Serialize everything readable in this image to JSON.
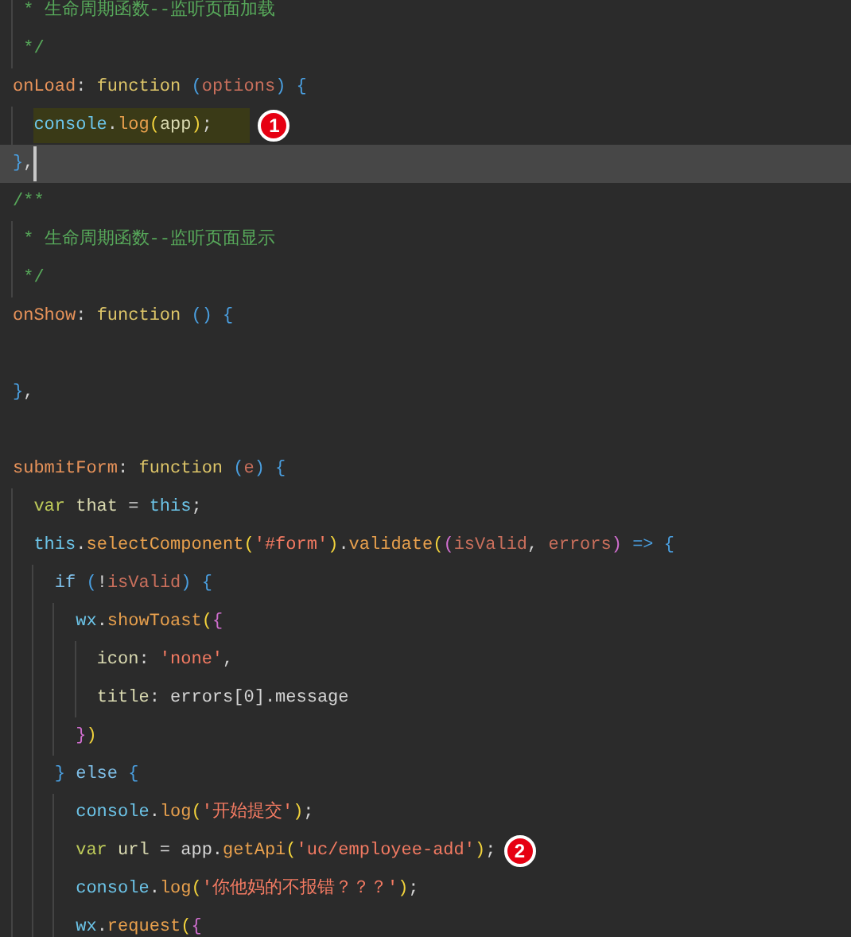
{
  "editor": {
    "lines": [
      {
        "kind": "code",
        "highlighted": false,
        "current": false,
        "tokens": [
          {
            "kind": "com",
            "text": " * 生命周期函数--监听页面加载"
          }
        ]
      },
      {
        "kind": "code",
        "highlighted": false,
        "current": false,
        "tokens": [
          {
            "kind": "com",
            "text": " */"
          }
        ]
      },
      {
        "kind": "code",
        "highlighted": false,
        "current": false,
        "tokens": [
          {
            "kind": "prop",
            "text": "onLoad"
          },
          {
            "kind": "p",
            "text": ": "
          },
          {
            "kind": "kw",
            "text": "function "
          },
          {
            "kind": "b1",
            "text": "("
          },
          {
            "kind": "param",
            "text": "options"
          },
          {
            "kind": "b1",
            "text": ") {"
          }
        ]
      },
      {
        "kind": "code",
        "highlighted": true,
        "current": false,
        "badge": "1",
        "tokens": [
          {
            "kind": "obj",
            "text": "  console"
          },
          {
            "kind": "p",
            "text": "."
          },
          {
            "kind": "fn",
            "text": "log"
          },
          {
            "kind": "b2",
            "text": "("
          },
          {
            "kind": "var",
            "text": "app"
          },
          {
            "kind": "b2",
            "text": ")"
          },
          {
            "kind": "p",
            "text": ";"
          }
        ]
      },
      {
        "kind": "code",
        "highlighted": false,
        "current": true,
        "tokens": [
          {
            "kind": "b1",
            "text": "}"
          },
          {
            "kind": "p",
            "text": ","
          }
        ]
      },
      {
        "kind": "code",
        "highlighted": false,
        "current": false,
        "tokens": [
          {
            "kind": "com",
            "text": "/**"
          }
        ]
      },
      {
        "kind": "code",
        "highlighted": false,
        "current": false,
        "tokens": [
          {
            "kind": "com",
            "text": " * 生命周期函数--监听页面显示"
          }
        ]
      },
      {
        "kind": "code",
        "highlighted": false,
        "current": false,
        "tokens": [
          {
            "kind": "com",
            "text": " */"
          }
        ]
      },
      {
        "kind": "code",
        "highlighted": false,
        "current": false,
        "tokens": [
          {
            "kind": "prop",
            "text": "onShow"
          },
          {
            "kind": "p",
            "text": ": "
          },
          {
            "kind": "kw",
            "text": "function "
          },
          {
            "kind": "b1",
            "text": "() {"
          }
        ]
      },
      {
        "kind": "blank"
      },
      {
        "kind": "code",
        "highlighted": false,
        "current": false,
        "tokens": [
          {
            "kind": "b1",
            "text": "}"
          },
          {
            "kind": "p",
            "text": ","
          }
        ]
      },
      {
        "kind": "blank"
      },
      {
        "kind": "code",
        "highlighted": false,
        "current": false,
        "tokens": [
          {
            "kind": "prop",
            "text": "submitForm"
          },
          {
            "kind": "p",
            "text": ": "
          },
          {
            "kind": "kw",
            "text": "function "
          },
          {
            "kind": "b1",
            "text": "("
          },
          {
            "kind": "param",
            "text": "e"
          },
          {
            "kind": "b1",
            "text": ") {"
          }
        ]
      },
      {
        "kind": "code",
        "highlighted": false,
        "current": false,
        "tokens": [
          {
            "kind": "kwv",
            "text": "  var "
          },
          {
            "kind": "var",
            "text": "that"
          },
          {
            "kind": "p",
            "text": " = "
          },
          {
            "kind": "obj",
            "text": "this"
          },
          {
            "kind": "p",
            "text": ";"
          }
        ]
      },
      {
        "kind": "code",
        "highlighted": false,
        "current": false,
        "tokens": [
          {
            "kind": "obj",
            "text": "  this"
          },
          {
            "kind": "p",
            "text": "."
          },
          {
            "kind": "fn",
            "text": "selectComponent"
          },
          {
            "kind": "b2",
            "text": "("
          },
          {
            "kind": "str",
            "text": "'#form'"
          },
          {
            "kind": "b2",
            "text": ")"
          },
          {
            "kind": "p",
            "text": "."
          },
          {
            "kind": "fn",
            "text": "validate"
          },
          {
            "kind": "b2",
            "text": "("
          },
          {
            "kind": "b3",
            "text": "("
          },
          {
            "kind": "param",
            "text": "isValid"
          },
          {
            "kind": "p",
            "text": ", "
          },
          {
            "kind": "param",
            "text": "errors"
          },
          {
            "kind": "b3",
            "text": ")"
          },
          {
            "kind": "b1",
            "text": " => {"
          }
        ]
      },
      {
        "kind": "code",
        "highlighted": false,
        "current": false,
        "tokens": [
          {
            "kind": "ctl",
            "text": "    if "
          },
          {
            "kind": "b1",
            "text": "("
          },
          {
            "kind": "p",
            "text": "!"
          },
          {
            "kind": "param",
            "text": "isValid"
          },
          {
            "kind": "b1",
            "text": ") {"
          }
        ]
      },
      {
        "kind": "code",
        "highlighted": false,
        "current": false,
        "tokens": [
          {
            "kind": "obj",
            "text": "      wx"
          },
          {
            "kind": "p",
            "text": "."
          },
          {
            "kind": "fn",
            "text": "showToast"
          },
          {
            "kind": "b2",
            "text": "("
          },
          {
            "kind": "b3",
            "text": "{"
          }
        ]
      },
      {
        "kind": "code",
        "highlighted": false,
        "current": false,
        "tokens": [
          {
            "kind": "var",
            "text": "        icon"
          },
          {
            "kind": "p",
            "text": ": "
          },
          {
            "kind": "str",
            "text": "'none'"
          },
          {
            "kind": "p",
            "text": ","
          }
        ]
      },
      {
        "kind": "code",
        "highlighted": false,
        "current": false,
        "tokens": [
          {
            "kind": "var",
            "text": "        title"
          },
          {
            "kind": "p",
            "text": ": errors[0].message"
          }
        ]
      },
      {
        "kind": "code",
        "highlighted": false,
        "current": false,
        "tokens": [
          {
            "kind": "b3",
            "text": "      }"
          },
          {
            "kind": "b2",
            "text": ")"
          }
        ]
      },
      {
        "kind": "code",
        "highlighted": false,
        "current": false,
        "tokens": [
          {
            "kind": "b1",
            "text": "    } "
          },
          {
            "kind": "ctl",
            "text": "else "
          },
          {
            "kind": "b1",
            "text": "{"
          }
        ]
      },
      {
        "kind": "code",
        "highlighted": false,
        "current": false,
        "tokens": [
          {
            "kind": "obj",
            "text": "      console"
          },
          {
            "kind": "p",
            "text": "."
          },
          {
            "kind": "fn",
            "text": "log"
          },
          {
            "kind": "b2",
            "text": "("
          },
          {
            "kind": "str",
            "text": "'开始提交'"
          },
          {
            "kind": "b2",
            "text": ")"
          },
          {
            "kind": "p",
            "text": ";"
          }
        ]
      },
      {
        "kind": "code",
        "highlighted": false,
        "current": false,
        "badge": "2",
        "tokens": [
          {
            "kind": "kwv",
            "text": "      var "
          },
          {
            "kind": "var",
            "text": "url"
          },
          {
            "kind": "p",
            "text": " = app."
          },
          {
            "kind": "fn",
            "text": "getApi"
          },
          {
            "kind": "b2",
            "text": "("
          },
          {
            "kind": "str",
            "text": "'uc/employee-add'"
          },
          {
            "kind": "b2",
            "text": ")"
          },
          {
            "kind": "p",
            "text": ";"
          }
        ]
      },
      {
        "kind": "code",
        "highlighted": false,
        "current": false,
        "tokens": [
          {
            "kind": "obj",
            "text": "      console"
          },
          {
            "kind": "p",
            "text": "."
          },
          {
            "kind": "fn",
            "text": "log"
          },
          {
            "kind": "b2",
            "text": "("
          },
          {
            "kind": "str",
            "text": "'你他妈的不报错？？？'"
          },
          {
            "kind": "b2",
            "text": ")"
          },
          {
            "kind": "p",
            "text": ";"
          }
        ]
      },
      {
        "kind": "code",
        "highlighted": false,
        "current": false,
        "tokens": [
          {
            "kind": "obj",
            "text": "      wx"
          },
          {
            "kind": "p",
            "text": "."
          },
          {
            "kind": "fn",
            "text": "request"
          },
          {
            "kind": "b2",
            "text": "("
          },
          {
            "kind": "b3",
            "text": "{"
          }
        ]
      }
    ]
  }
}
